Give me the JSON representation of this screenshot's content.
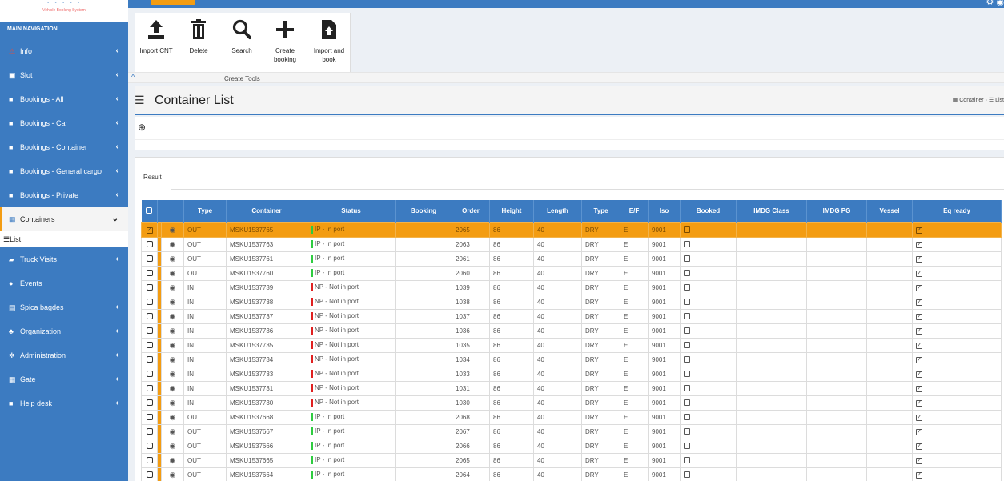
{
  "logo": {
    "mark": "ˇ ˇ ˇ ˇ ˇ",
    "subtitle": "Vehicle Booking System"
  },
  "sidebar": {
    "header": "MAIN NAVIGATION",
    "items": [
      {
        "label": "Info",
        "icon": "warning-icon",
        "has_chevron": true
      },
      {
        "label": "Slot",
        "icon": "calendar-icon",
        "has_chevron": true
      },
      {
        "label": "Bookings - All",
        "icon": "folder-icon",
        "has_chevron": true
      },
      {
        "label": "Bookings - Car",
        "icon": "folder-icon",
        "has_chevron": true
      },
      {
        "label": "Bookings - Container",
        "icon": "folder-icon",
        "has_chevron": true
      },
      {
        "label": "Bookings - General cargo",
        "icon": "folder-icon",
        "has_chevron": true
      },
      {
        "label": "Bookings - Private",
        "icon": "folder-icon",
        "has_chevron": true
      },
      {
        "label": "Containers",
        "icon": "grid-icon",
        "has_chevron": true,
        "active": true
      },
      {
        "label": "Truck Visits",
        "icon": "truck-icon",
        "has_chevron": true
      },
      {
        "label": "Events",
        "icon": "info-circle-icon",
        "has_chevron": false
      },
      {
        "label": "Spica bagdes",
        "icon": "id-card-icon",
        "has_chevron": true
      },
      {
        "label": "Organization",
        "icon": "users-icon",
        "has_chevron": true
      },
      {
        "label": "Administration",
        "icon": "cogs-icon",
        "has_chevron": true
      },
      {
        "label": "Gate",
        "icon": "grid-icon",
        "has_chevron": true
      },
      {
        "label": "Help desk",
        "icon": "folder-icon",
        "has_chevron": true
      }
    ],
    "sub_item": "List"
  },
  "toolbar": {
    "tools": [
      {
        "label": "Import CNT",
        "icon": "upload-icon"
      },
      {
        "label": "Delete",
        "icon": "trash-icon"
      },
      {
        "label": "Search",
        "icon": "search-icon"
      },
      {
        "label": "Create booking",
        "icon": "plus-icon"
      },
      {
        "label": "Import and book",
        "icon": "file-import-icon"
      }
    ],
    "group_label": "Create Tools"
  },
  "page": {
    "title": "Container List",
    "breadcrumb": [
      "Container",
      "List"
    ],
    "tab": "Result"
  },
  "colors": {
    "primary": "#3c7bc1",
    "accent": "#f39c12",
    "in_port": "#2ecc40",
    "not_in_port": "#e02020"
  },
  "table": {
    "columns": [
      "Type",
      "Container",
      "Status",
      "Booking",
      "Order",
      "Height",
      "Length",
      "Type",
      "E/F",
      "Iso",
      "Booked",
      "IMDG Class",
      "IMDG PG",
      "Vessel",
      "Eq ready"
    ],
    "rows": [
      {
        "dir": "OUT",
        "container": "MSKU1537765",
        "status": "IP - In port",
        "in_port": true,
        "booking": "",
        "order": "2065",
        "height": "86",
        "length": "40",
        "ctype": "DRY",
        "ef": "E",
        "iso": "9001",
        "selected": true
      },
      {
        "dir": "OUT",
        "container": "MSKU1537763",
        "status": "IP - In port",
        "in_port": true,
        "booking": "",
        "order": "2063",
        "height": "86",
        "length": "40",
        "ctype": "DRY",
        "ef": "E",
        "iso": "9001"
      },
      {
        "dir": "OUT",
        "container": "MSKU1537761",
        "status": "IP - In port",
        "in_port": true,
        "booking": "",
        "order": "2061",
        "height": "86",
        "length": "40",
        "ctype": "DRY",
        "ef": "E",
        "iso": "9001"
      },
      {
        "dir": "OUT",
        "container": "MSKU1537760",
        "status": "IP - In port",
        "in_port": true,
        "booking": "",
        "order": "2060",
        "height": "86",
        "length": "40",
        "ctype": "DRY",
        "ef": "E",
        "iso": "9001"
      },
      {
        "dir": "IN",
        "container": "MSKU1537739",
        "status": "NP - Not in port",
        "in_port": false,
        "booking": "",
        "order": "1039",
        "height": "86",
        "length": "40",
        "ctype": "DRY",
        "ef": "E",
        "iso": "9001"
      },
      {
        "dir": "IN",
        "container": "MSKU1537738",
        "status": "NP - Not in port",
        "in_port": false,
        "booking": "",
        "order": "1038",
        "height": "86",
        "length": "40",
        "ctype": "DRY",
        "ef": "E",
        "iso": "9001"
      },
      {
        "dir": "IN",
        "container": "MSKU1537737",
        "status": "NP - Not in port",
        "in_port": false,
        "booking": "",
        "order": "1037",
        "height": "86",
        "length": "40",
        "ctype": "DRY",
        "ef": "E",
        "iso": "9001"
      },
      {
        "dir": "IN",
        "container": "MSKU1537736",
        "status": "NP - Not in port",
        "in_port": false,
        "booking": "",
        "order": "1036",
        "height": "86",
        "length": "40",
        "ctype": "DRY",
        "ef": "E",
        "iso": "9001"
      },
      {
        "dir": "IN",
        "container": "MSKU1537735",
        "status": "NP - Not in port",
        "in_port": false,
        "booking": "",
        "order": "1035",
        "height": "86",
        "length": "40",
        "ctype": "DRY",
        "ef": "E",
        "iso": "9001"
      },
      {
        "dir": "IN",
        "container": "MSKU1537734",
        "status": "NP - Not in port",
        "in_port": false,
        "booking": "",
        "order": "1034",
        "height": "86",
        "length": "40",
        "ctype": "DRY",
        "ef": "E",
        "iso": "9001"
      },
      {
        "dir": "IN",
        "container": "MSKU1537733",
        "status": "NP - Not in port",
        "in_port": false,
        "booking": "",
        "order": "1033",
        "height": "86",
        "length": "40",
        "ctype": "DRY",
        "ef": "E",
        "iso": "9001"
      },
      {
        "dir": "IN",
        "container": "MSKU1537731",
        "status": "NP - Not in port",
        "in_port": false,
        "booking": "",
        "order": "1031",
        "height": "86",
        "length": "40",
        "ctype": "DRY",
        "ef": "E",
        "iso": "9001"
      },
      {
        "dir": "IN",
        "container": "MSKU1537730",
        "status": "NP - Not in port",
        "in_port": false,
        "booking": "",
        "order": "1030",
        "height": "86",
        "length": "40",
        "ctype": "DRY",
        "ef": "E",
        "iso": "9001"
      },
      {
        "dir": "OUT",
        "container": "MSKU1537668",
        "status": "IP - In port",
        "in_port": true,
        "booking": "",
        "order": "2068",
        "height": "86",
        "length": "40",
        "ctype": "DRY",
        "ef": "E",
        "iso": "9001"
      },
      {
        "dir": "OUT",
        "container": "MSKU1537667",
        "status": "IP - In port",
        "in_port": true,
        "booking": "",
        "order": "2067",
        "height": "86",
        "length": "40",
        "ctype": "DRY",
        "ef": "E",
        "iso": "9001"
      },
      {
        "dir": "OUT",
        "container": "MSKU1537666",
        "status": "IP - In port",
        "in_port": true,
        "booking": "",
        "order": "2066",
        "height": "86",
        "length": "40",
        "ctype": "DRY",
        "ef": "E",
        "iso": "9001"
      },
      {
        "dir": "OUT",
        "container": "MSKU1537665",
        "status": "IP - In port",
        "in_port": true,
        "booking": "",
        "order": "2065",
        "height": "86",
        "length": "40",
        "ctype": "DRY",
        "ef": "E",
        "iso": "9001"
      },
      {
        "dir": "OUT",
        "container": "MSKU1537664",
        "status": "IP - In port",
        "in_port": true,
        "booking": "",
        "order": "2064",
        "height": "86",
        "length": "40",
        "ctype": "DRY",
        "ef": "E",
        "iso": "9001"
      }
    ]
  }
}
